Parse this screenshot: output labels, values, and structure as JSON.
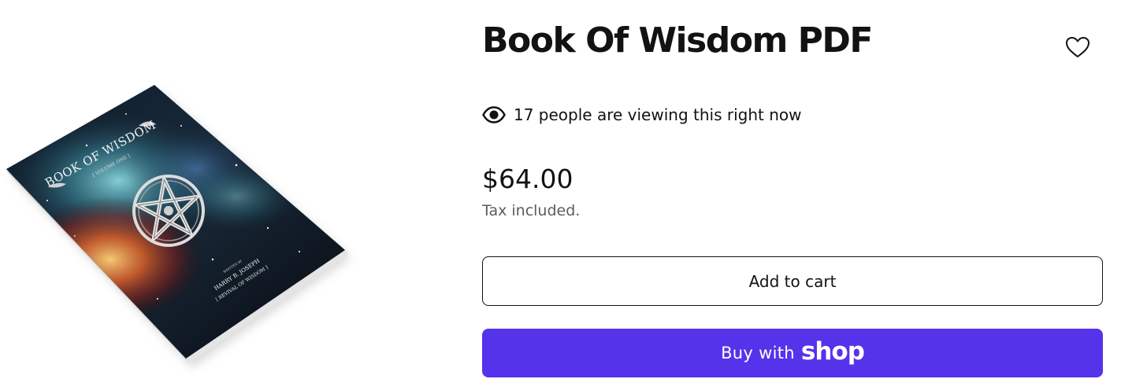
{
  "product": {
    "title": "Book Of Wisdom PDF",
    "viewers_text": "17 people are viewing this right now",
    "price": "$64.00",
    "tax_note": "Tax included."
  },
  "book_cover": {
    "title": "BOOK OF WISDOM",
    "subtitle": "[ VOLUME ONE ]",
    "author_prefix": "WRITTEN BY",
    "author": "HARRY B. JOSEPH",
    "publisher": "[ REVIVAL OF WISDOM ]"
  },
  "actions": {
    "add_to_cart_label": "Add to cart",
    "buy_with_label": "Buy with",
    "shop_brand": "shop"
  },
  "colors": {
    "shop_button": "#5433eb",
    "text": "#121212",
    "muted_text": "#5c5c5c"
  },
  "icons": {
    "wishlist": "heart-outline-icon",
    "viewers": "eye-icon"
  }
}
